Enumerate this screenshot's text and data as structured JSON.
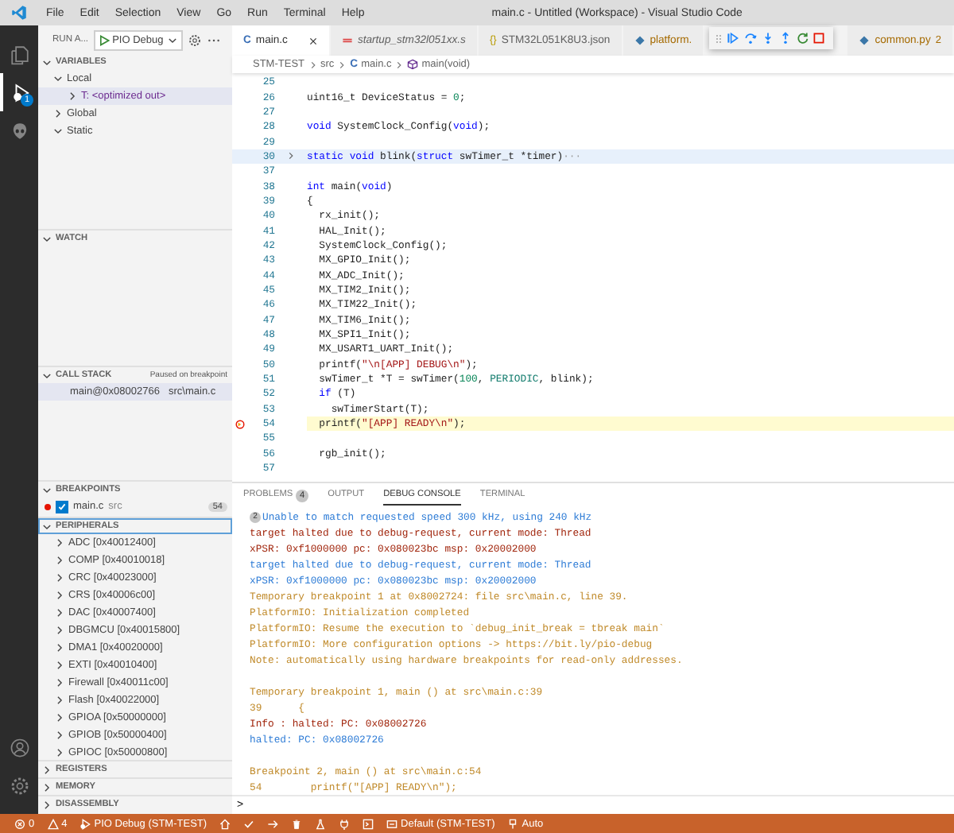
{
  "window": {
    "title": "main.c - Untitled (Workspace) - Visual Studio Code"
  },
  "menu": [
    "File",
    "Edit",
    "Selection",
    "View",
    "Go",
    "Run",
    "Terminal",
    "Help"
  ],
  "activity_bar": [
    {
      "kind": "files",
      "selected": false
    },
    {
      "kind": "debug",
      "selected": true,
      "badge": "1"
    },
    {
      "kind": "alien",
      "selected": false
    },
    {
      "kind": "account",
      "selected": false
    },
    {
      "kind": "settings",
      "selected": false
    }
  ],
  "sidebar": {
    "title": "RUN A...",
    "config": "PIO Debug",
    "variables": {
      "title": "VARIABLES",
      "expanded": true,
      "items": [
        {
          "label": "Local",
          "expanded": true,
          "selected": false,
          "children": [
            {
              "label": "T: <optimized out>",
              "expanded": false,
              "selected": true
            }
          ]
        },
        {
          "label": "Global",
          "expanded": false,
          "selected": false
        },
        {
          "label": "Static",
          "expanded": true,
          "selected": false
        }
      ]
    },
    "watch": {
      "title": "WATCH",
      "expanded": true
    },
    "call_stack": {
      "title": "CALL STACK",
      "status": "Paused on breakpoint",
      "frames": [
        {
          "name": "main@0x08002766",
          "file": "src\\main.c",
          "selected": true
        }
      ]
    },
    "breakpoints": {
      "title": "BREAKPOINTS",
      "expanded": true,
      "items": [
        {
          "file": "main.c",
          "folder": "src",
          "line": "54",
          "checked": true
        }
      ]
    },
    "peripherals": {
      "title": "PERIPHERALS",
      "expanded": true,
      "items": [
        {
          "label": "ADC [0x40012400]"
        },
        {
          "label": "COMP [0x40010018]"
        },
        {
          "label": "CRC [0x40023000]"
        },
        {
          "label": "CRS [0x40006c00]"
        },
        {
          "label": "DAC [0x40007400]"
        },
        {
          "label": "DBGMCU [0x40015800]"
        },
        {
          "label": "DMA1 [0x40020000]"
        },
        {
          "label": "EXTI [0x40010400]"
        },
        {
          "label": "Firewall [0x40011c00]"
        },
        {
          "label": "Flash [0x40022000]"
        },
        {
          "label": "GPIOA [0x50000000]"
        },
        {
          "label": "GPIOB [0x50000400]"
        },
        {
          "label": "GPIOC [0x50000800]"
        }
      ]
    },
    "collapsed_sections": [
      {
        "title": "REGISTERS",
        "expanded": false
      },
      {
        "title": "MEMORY",
        "expanded": false
      },
      {
        "title": "DISASSEMBLY",
        "expanded": false
      }
    ]
  },
  "tabs": [
    {
      "label": "main.c",
      "kind": "c",
      "icon": "C",
      "selected": true,
      "preview": false,
      "warning": false
    },
    {
      "label": "startup_stm32l051xx.s",
      "kind": "asm",
      "selected": false,
      "preview": true,
      "warning": false
    },
    {
      "label": "STM32L051K8U3.json",
      "kind": "json",
      "icon": "{}",
      "selected": false,
      "preview": false,
      "warning": false
    },
    {
      "label": "platform.",
      "kind": "py",
      "selected": false,
      "preview": false,
      "warning": true
    },
    {
      "label": "common.py",
      "kind": "py",
      "selected": false,
      "preview": false,
      "warning": true,
      "problems": "2"
    }
  ],
  "debug_toolbar": [
    {
      "kind": "continue"
    },
    {
      "kind": "step-over"
    },
    {
      "kind": "step-into"
    },
    {
      "kind": "step-out"
    },
    {
      "kind": "restart"
    },
    {
      "kind": "stop"
    }
  ],
  "breadcrumbs": [
    {
      "label": "STM-TEST",
      "kind": "folder"
    },
    {
      "label": "src",
      "kind": "folder"
    },
    {
      "label": "main.c",
      "kind": "c",
      "icon": "C"
    },
    {
      "label": "main(void)",
      "kind": "function"
    }
  ],
  "code": [
    {
      "number": "25"
    },
    {
      "number": "26",
      "segments": [
        {
          "text": "uint16_t DeviceStatus = ",
          "kind": "plain"
        },
        {
          "text": "0",
          "kind": "number"
        },
        {
          "text": ";",
          "kind": "plain"
        }
      ]
    },
    {
      "number": "27"
    },
    {
      "number": "28",
      "segments": [
        {
          "text": "void",
          "kind": "keyword"
        },
        {
          "text": " SystemClock_Config(",
          "kind": "plain"
        },
        {
          "text": "void",
          "kind": "keyword"
        },
        {
          "text": ");",
          "kind": "plain"
        }
      ]
    },
    {
      "number": "29"
    },
    {
      "number": "30",
      "folded": true,
      "segments": [
        {
          "text": "static void",
          "kind": "keyword"
        },
        {
          "text": " blink(",
          "kind": "plain"
        },
        {
          "text": "struct",
          "kind": "keyword"
        },
        {
          "text": " swTimer_t *timer)",
          "kind": "plain"
        },
        {
          "text": "···",
          "kind": "fold"
        }
      ]
    },
    {
      "number": "37"
    },
    {
      "number": "38",
      "segments": [
        {
          "text": "int",
          "kind": "keyword"
        },
        {
          "text": " main(",
          "kind": "plain"
        },
        {
          "text": "void",
          "kind": "keyword"
        },
        {
          "text": ")",
          "kind": "plain"
        }
      ]
    },
    {
      "number": "39",
      "segments": [
        {
          "text": "{",
          "kind": "plain"
        }
      ]
    },
    {
      "number": "40",
      "segments": [
        {
          "text": "  rx_init();",
          "kind": "plain"
        }
      ]
    },
    {
      "number": "41",
      "segments": [
        {
          "text": "  HAL_Init();",
          "kind": "plain"
        }
      ]
    },
    {
      "number": "42",
      "segments": [
        {
          "text": "  SystemClock_Config();",
          "kind": "plain"
        }
      ]
    },
    {
      "number": "43",
      "segments": [
        {
          "text": "  MX_GPIO_Init();",
          "kind": "plain"
        }
      ]
    },
    {
      "number": "44",
      "segments": [
        {
          "text": "  MX_ADC_Init();",
          "kind": "plain"
        }
      ]
    },
    {
      "number": "45",
      "segments": [
        {
          "text": "  MX_TIM2_Init();",
          "kind": "plain"
        }
      ]
    },
    {
      "number": "46",
      "segments": [
        {
          "text": "  MX_TIM22_Init();",
          "kind": "plain"
        }
      ]
    },
    {
      "number": "47",
      "segments": [
        {
          "text": "  MX_TIM6_Init();",
          "kind": "plain"
        }
      ]
    },
    {
      "number": "48",
      "segments": [
        {
          "text": "  MX_SPI1_Init();",
          "kind": "plain"
        }
      ]
    },
    {
      "number": "49",
      "segments": [
        {
          "text": "  MX_USART1_UART_Init();",
          "kind": "plain"
        }
      ]
    },
    {
      "number": "50",
      "segments": [
        {
          "text": "  printf(",
          "kind": "plain"
        },
        {
          "text": "\"\\n[APP] DEBUG\\n\"",
          "kind": "string"
        },
        {
          "text": ");",
          "kind": "plain"
        }
      ]
    },
    {
      "number": "51",
      "segments": [
        {
          "text": "  swTimer_t *T = swTimer(",
          "kind": "plain"
        },
        {
          "text": "100",
          "kind": "number"
        },
        {
          "text": ", ",
          "kind": "plain"
        },
        {
          "text": "PERIODIC",
          "kind": "macro"
        },
        {
          "text": ", blink);",
          "kind": "plain"
        }
      ]
    },
    {
      "number": "52",
      "segments": [
        {
          "text": "  if",
          "kind": "keyword"
        },
        {
          "text": " (T)",
          "kind": "plain"
        }
      ]
    },
    {
      "number": "53",
      "segments": [
        {
          "text": "    swTimerStart(T);",
          "kind": "plain"
        }
      ]
    },
    {
      "number": "54",
      "current": true,
      "segments": [
        {
          "text": "  printf(",
          "kind": "plain"
        },
        {
          "text": "\"[APP] READY\\n\"",
          "kind": "string"
        },
        {
          "text": ");",
          "kind": "plain"
        }
      ]
    },
    {
      "number": "55"
    },
    {
      "number": "56",
      "segments": [
        {
          "text": "  rgb_init();",
          "kind": "plain"
        }
      ]
    },
    {
      "number": "57"
    }
  ],
  "panel": {
    "tabs": [
      {
        "label": "PROBLEMS",
        "count": "4",
        "selected": false
      },
      {
        "label": "OUTPUT",
        "selected": false
      },
      {
        "label": "DEBUG CONSOLE",
        "selected": true
      },
      {
        "label": "TERMINAL",
        "selected": false
      }
    ],
    "console": [
      {
        "kind": "info",
        "count": "2",
        "text": "Unable to match requested speed 300 kHz, using 240 kHz"
      },
      {
        "kind": "error",
        "text": "target halted due to debug-request, current mode: Thread"
      },
      {
        "kind": "error",
        "text": "xPSR: 0xf1000000 pc: 0x080023bc msp: 0x20002000"
      },
      {
        "kind": "info",
        "text": "target halted due to debug-request, current mode: Thread"
      },
      {
        "kind": "info",
        "text": "xPSR: 0xf1000000 pc: 0x080023bc msp: 0x20002000"
      },
      {
        "kind": "warn",
        "text": "Temporary breakpoint 1 at 0x8002724: file src\\main.c, line 39."
      },
      {
        "kind": "warn",
        "text": "PlatformIO: Initialization completed"
      },
      {
        "kind": "warn",
        "text": "PlatformIO: Resume the execution to `debug_init_break = tbreak main`"
      },
      {
        "kind": "warn",
        "text": "PlatformIO: More configuration options -> https://bit.ly/pio-debug"
      },
      {
        "kind": "warn",
        "text": "Note: automatically using hardware breakpoints for read-only addresses."
      },
      {
        "kind": "spacer"
      },
      {
        "kind": "warn",
        "text": "Temporary breakpoint 1, main () at src\\main.c:39"
      },
      {
        "kind": "warn",
        "text": "39      {"
      },
      {
        "kind": "error",
        "text": "Info : halted: PC: 0x08002726"
      },
      {
        "kind": "info",
        "text": "halted: PC: 0x08002726"
      },
      {
        "kind": "spacer"
      },
      {
        "kind": "warn",
        "text": "Breakpoint 2, main () at src\\main.c:54"
      },
      {
        "kind": "warn",
        "text": "54        printf(\"[APP] READY\\n\");"
      }
    ],
    "prompt": ">"
  },
  "status_bar": [
    {
      "kind": "errors",
      "text": "0"
    },
    {
      "kind": "warnings",
      "text": "4"
    },
    {
      "kind": "debug",
      "text": "PIO Debug (STM-TEST)"
    },
    {
      "kind": "home"
    },
    {
      "kind": "check"
    },
    {
      "kind": "arrow"
    },
    {
      "kind": "trash"
    },
    {
      "kind": "flask"
    },
    {
      "kind": "plug"
    },
    {
      "kind": "terminal"
    },
    {
      "kind": "env",
      "text": "Default (STM-TEST)"
    },
    {
      "kind": "port",
      "text": "Auto"
    }
  ]
}
